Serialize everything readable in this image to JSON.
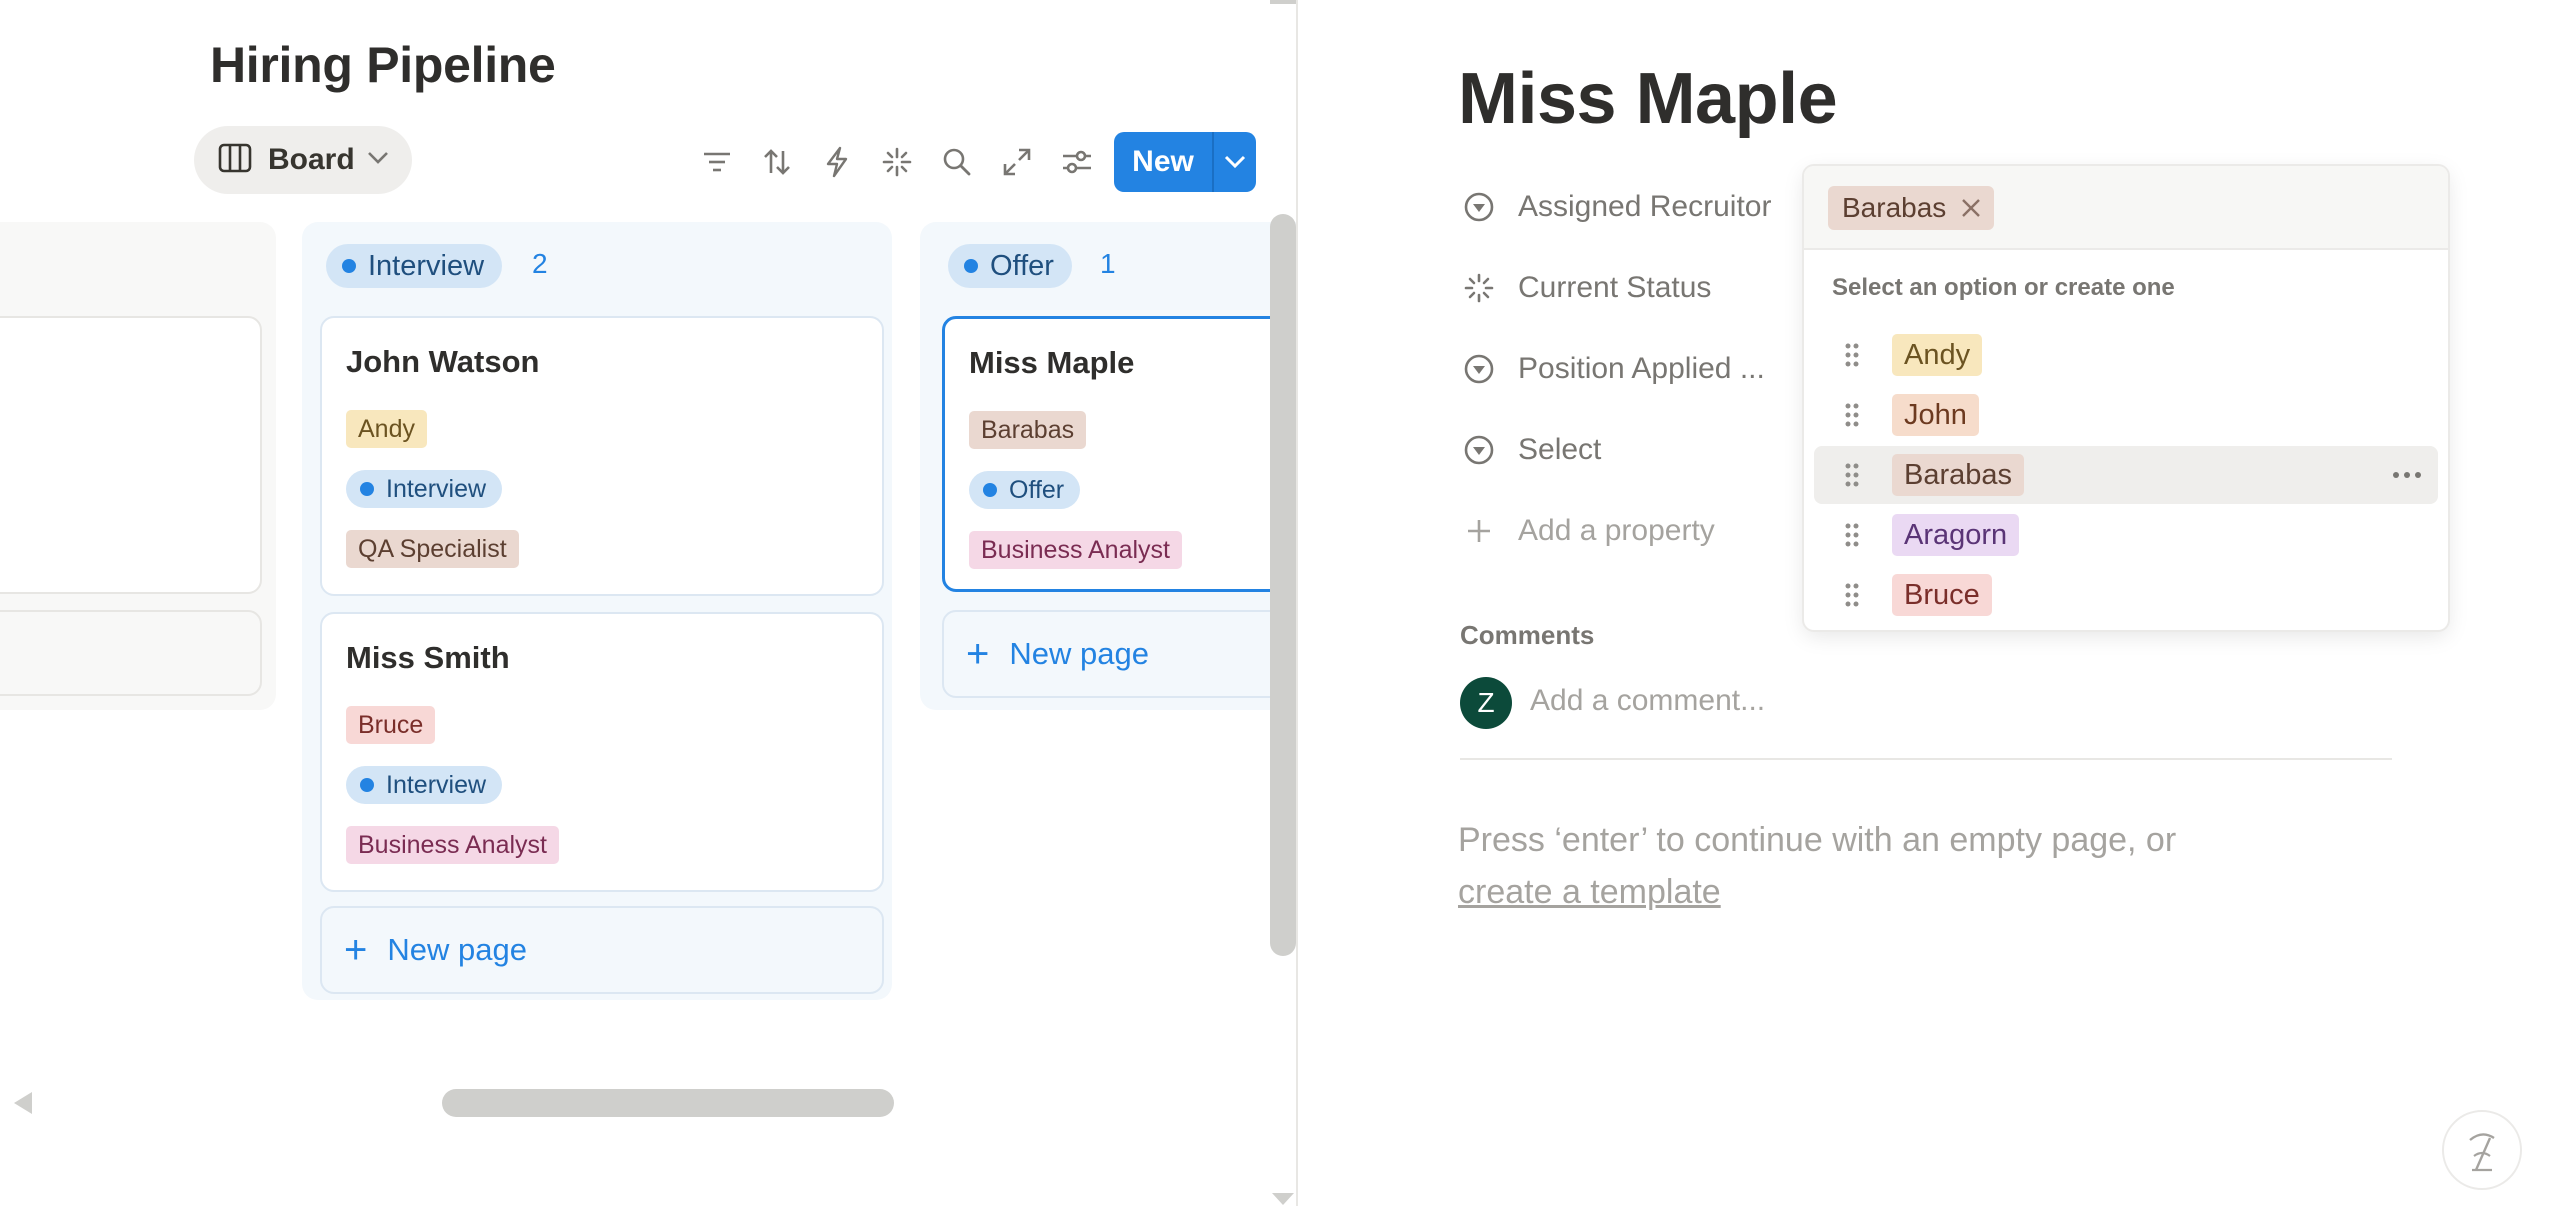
{
  "board": {
    "title": "Hiring Pipeline",
    "view_label": "Board",
    "toolbar_icons": [
      "filter-icon",
      "sort-icon",
      "automation-icon",
      "ai-icon",
      "search-icon",
      "expand-icon",
      "settings-icon"
    ],
    "new_label": "New",
    "columns": [
      {
        "name": "Interview",
        "count": "2",
        "cards": [
          {
            "title": "John Watson",
            "recruiter": "Andy",
            "status": "Interview",
            "position": "QA Specialist"
          },
          {
            "title": "Miss Smith",
            "recruiter": "Bruce",
            "status": "Interview",
            "position": "Business Analyst"
          }
        ],
        "new_page_label": "New page"
      },
      {
        "name": "Offer",
        "count": "1",
        "cards": [
          {
            "title": "Miss Maple",
            "recruiter": "Barabas",
            "status": "Offer",
            "position": "Business Analyst"
          }
        ],
        "new_page_label": "New page"
      }
    ],
    "accent_color": "#2383e2"
  },
  "detail": {
    "title": "Miss Maple",
    "properties": [
      {
        "label": "Assigned Recruitor",
        "icon": "select-icon"
      },
      {
        "label": "Current Status",
        "icon": "status-icon"
      },
      {
        "label": "Position Applied ...",
        "icon": "select-icon"
      },
      {
        "label": "Select",
        "icon": "select-icon"
      }
    ],
    "add_property_label": "Add a property",
    "comments_heading": "Comments",
    "avatar_initial": "Z",
    "comment_placeholder": "Add a comment...",
    "hint_text": "Press ‘enter’ to continue with an empty page, or",
    "hint_link": "create a template"
  },
  "dropdown": {
    "selected": "Barabas",
    "hint": "Select an option or create one",
    "options": [
      {
        "label": "Andy",
        "color": "#f8e7bd"
      },
      {
        "label": "John",
        "color": "#f6dccb"
      },
      {
        "label": "Barabas",
        "color": "#ead8d0",
        "highlighted": true
      },
      {
        "label": "Aragorn",
        "color": "#ead9f3"
      },
      {
        "label": "Bruce",
        "color": "#f8d8d6"
      }
    ]
  }
}
